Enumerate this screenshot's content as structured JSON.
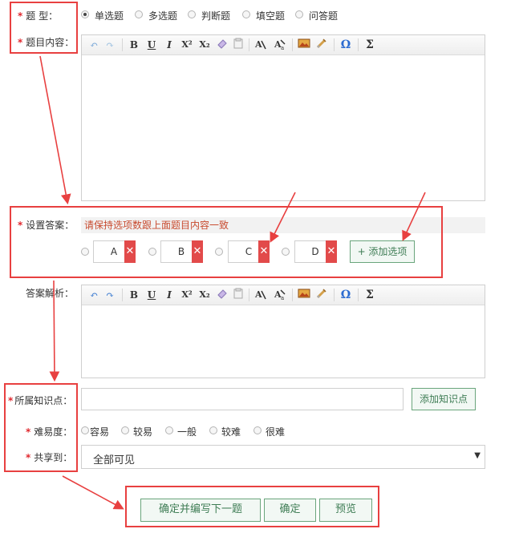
{
  "question_type": {
    "label": "题    型：",
    "options": [
      "单选题",
      "多选题",
      "判断题",
      "填空题",
      "问答题"
    ],
    "selected_index": 0
  },
  "content": {
    "label": "题目内容："
  },
  "answer": {
    "label": "设置答案：",
    "hint": "请保持选项数跟上面题目内容一致",
    "options": [
      "A",
      "B",
      "C",
      "D"
    ],
    "delete_symbol": "✕",
    "add_label": "+ 添加选项"
  },
  "analysis": {
    "label": "答案解析："
  },
  "knowledge": {
    "label": "所属知识点：",
    "value": "",
    "add_label": "添加知识点"
  },
  "difficulty": {
    "label": "难易度：",
    "options": [
      "容易",
      "较易",
      "一般",
      "较难",
      "很难"
    ],
    "selected_index": -1
  },
  "share": {
    "label": "共享到：",
    "value": "全部可见",
    "arrow": "▼"
  },
  "actions": {
    "save_next": "确定并编写下一题",
    "confirm": "确定",
    "preview": "预览"
  },
  "toolbar": {
    "buttons": [
      "undo-icon",
      "redo-icon",
      "bold",
      "underline",
      "italic",
      "superscript",
      "subscript",
      "eraser-icon",
      "paste-icon",
      "font-color-icon",
      "background-color-icon",
      "image-icon",
      "scrawl-icon",
      "special-char-icon",
      "formula-icon"
    ],
    "glyphs": {
      "bold": "B",
      "underline": "U",
      "italic": "I",
      "superscript": "X²",
      "subscript": "X₂",
      "special": "Ω",
      "formula": "Σ"
    }
  },
  "colors": {
    "required": "#e0282e",
    "annotation": "#e84040",
    "green": "#3f7d55",
    "hint_text": "#c84b2f"
  }
}
